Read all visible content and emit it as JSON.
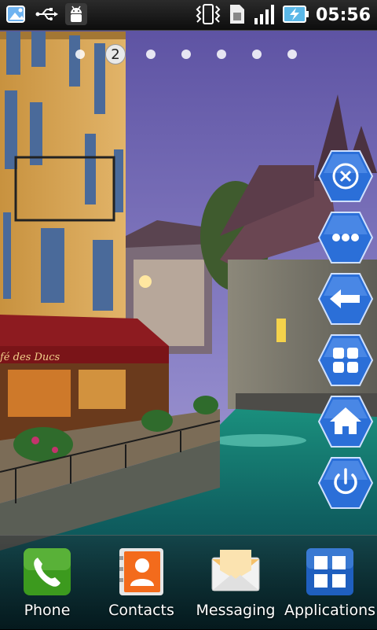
{
  "status_bar": {
    "time": "05:56",
    "icons": [
      "photo-app-icon",
      "usb-icon",
      "android-debug-icon",
      "vibrate-icon",
      "sim-icon",
      "signal-icon",
      "battery-charging-icon"
    ]
  },
  "page_indicator": {
    "current_page": "2",
    "total_pages": 7
  },
  "wallpaper": {
    "sign_text": "fé des Ducs"
  },
  "side_buttons": [
    {
      "name": "close-icon"
    },
    {
      "name": "more-icon"
    },
    {
      "name": "back-arrow-icon"
    },
    {
      "name": "apps-grid-icon"
    },
    {
      "name": "home-icon"
    },
    {
      "name": "power-icon"
    }
  ],
  "dock": {
    "phone": "Phone",
    "contacts": "Contacts",
    "messaging": "Messaging",
    "applications": "Applications"
  },
  "colors": {
    "hex_button": "#2b6fd8",
    "hex_button_dark": "#1a4fa8",
    "phone_green": "#3c9a1e",
    "contacts_orange": "#f36b1c",
    "apps_blue": "#1f5fbf"
  }
}
